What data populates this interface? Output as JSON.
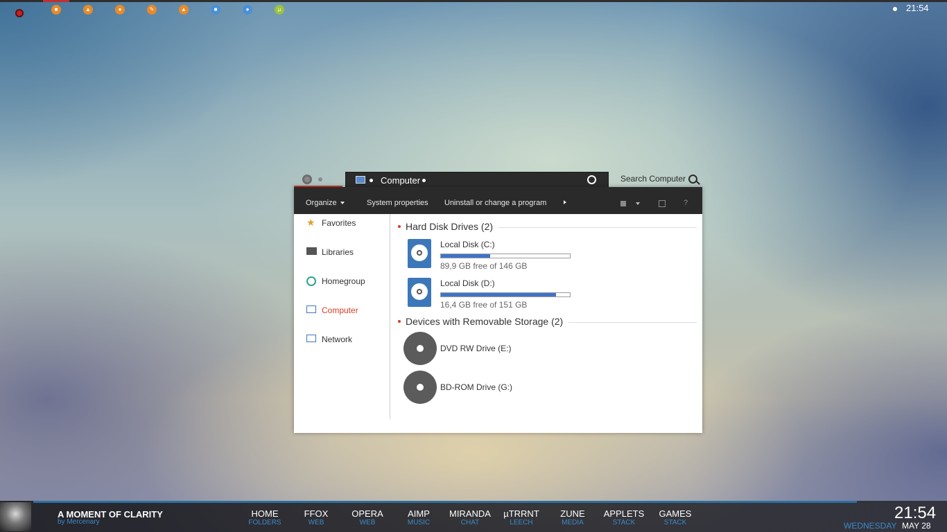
{
  "desktop": {
    "dock_icons": [
      {
        "name": "record",
        "color": "#c82020"
      },
      {
        "name": "app-1",
        "color": "#e88a2a"
      },
      {
        "name": "vlc",
        "color": "#e88a2a"
      },
      {
        "name": "firefox",
        "color": "#e88a2a"
      },
      {
        "name": "pencil",
        "color": "#e88a2a"
      },
      {
        "name": "vlc-2",
        "color": "#e88a2a"
      },
      {
        "name": "app-blue",
        "color": "#4a8fd8"
      },
      {
        "name": "chrome",
        "color": "#4a8fd8"
      },
      {
        "name": "utorrent",
        "color": "#9cc23a"
      }
    ],
    "tray_clock": "21:54"
  },
  "window": {
    "breadcrumb": "Computer",
    "search_label": "Search Computer",
    "toolbar": {
      "organize": "Organize",
      "system_properties": "System properties",
      "uninstall": "Uninstall or change a program",
      "help": "?"
    },
    "nav": [
      {
        "label": "Favorites",
        "icon": "star-icon"
      },
      {
        "label": "Libraries",
        "icon": "libraries-icon"
      },
      {
        "label": "Homegroup",
        "icon": "homegroup-icon"
      },
      {
        "label": "Computer",
        "icon": "computer-icon",
        "active": true
      },
      {
        "label": "Network",
        "icon": "network-icon"
      }
    ],
    "groups": {
      "hard_disks": "Hard Disk Drives (2)",
      "removable": "Devices with Removable Storage (2)"
    },
    "drives": [
      {
        "name": "Local Disk (C:)",
        "free": "89,9 GB free of 146 GB",
        "used_fraction": 0.384
      },
      {
        "name": "Local Disk (D:)",
        "free": "16,4 GB free of 151 GB",
        "used_fraction": 0.891
      }
    ],
    "removable": [
      {
        "name": "DVD RW Drive (E:)"
      },
      {
        "name": "BD-ROM Drive (G:)"
      }
    ]
  },
  "bottombar": {
    "theme_title": "A MOMENT OF CLARITY",
    "theme_author": "by Mercenary",
    "menu": [
      {
        "label": "HOME",
        "sub": "FOLDERS"
      },
      {
        "label": "FFOX",
        "sub": "WEB"
      },
      {
        "label": "OPERA",
        "sub": "WEB"
      },
      {
        "label": "AIMP",
        "sub": "MUSIC"
      },
      {
        "label": "MIRANDA",
        "sub": "CHAT"
      },
      {
        "label": "µTRRNT",
        "sub": "LEECH"
      },
      {
        "label": "ZUNE",
        "sub": "MEDIA"
      },
      {
        "label": "APPLETS",
        "sub": "STACK"
      },
      {
        "label": "GAMES",
        "sub": "STACK"
      }
    ],
    "clock": "21:54",
    "day": "WEDNESDAY",
    "date": "MAY 28",
    "accent_color": "#3b8ac8"
  }
}
